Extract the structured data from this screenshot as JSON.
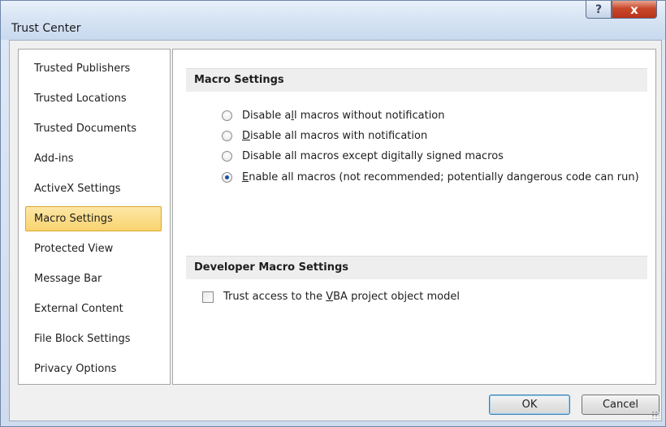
{
  "window": {
    "title": "Trust Center",
    "help_label": "?",
    "close_label": "x"
  },
  "sidebar": {
    "items": [
      {
        "label": "Trusted Publishers"
      },
      {
        "label": "Trusted Locations"
      },
      {
        "label": "Trusted Documents"
      },
      {
        "label": "Add-ins"
      },
      {
        "label": "ActiveX Settings"
      },
      {
        "label": "Macro Settings",
        "selected": true
      },
      {
        "label": "Protected View"
      },
      {
        "label": "Message Bar"
      },
      {
        "label": "External Content"
      },
      {
        "label": "File Block Settings"
      },
      {
        "label": "Privacy Options"
      }
    ]
  },
  "macro_settings": {
    "header": "Macro Settings",
    "options": [
      {
        "pre": "Disable a",
        "ul": "l",
        "post": "l macros without notification",
        "checked": false
      },
      {
        "pre": "",
        "ul": "D",
        "post": "isable all macros with notification",
        "checked": false
      },
      {
        "pre": "Disable all macros except di",
        "ul": "g",
        "post": "itally signed macros",
        "checked": false
      },
      {
        "pre": "",
        "ul": "E",
        "post": "nable all macros (not recommended; potentially dangerous code can run)",
        "checked": true
      }
    ]
  },
  "developer_macro_settings": {
    "header": "Developer Macro Settings",
    "checkbox": {
      "pre": "Trust access to the ",
      "ul": "V",
      "post": "BA project object model",
      "checked": false
    }
  },
  "buttons": {
    "ok": "OK",
    "cancel": "Cancel"
  },
  "colors": {
    "selected_nav_bg": "#f9d36f",
    "close_button": "#c9472a",
    "section_header_bg": "#eeeeee"
  }
}
